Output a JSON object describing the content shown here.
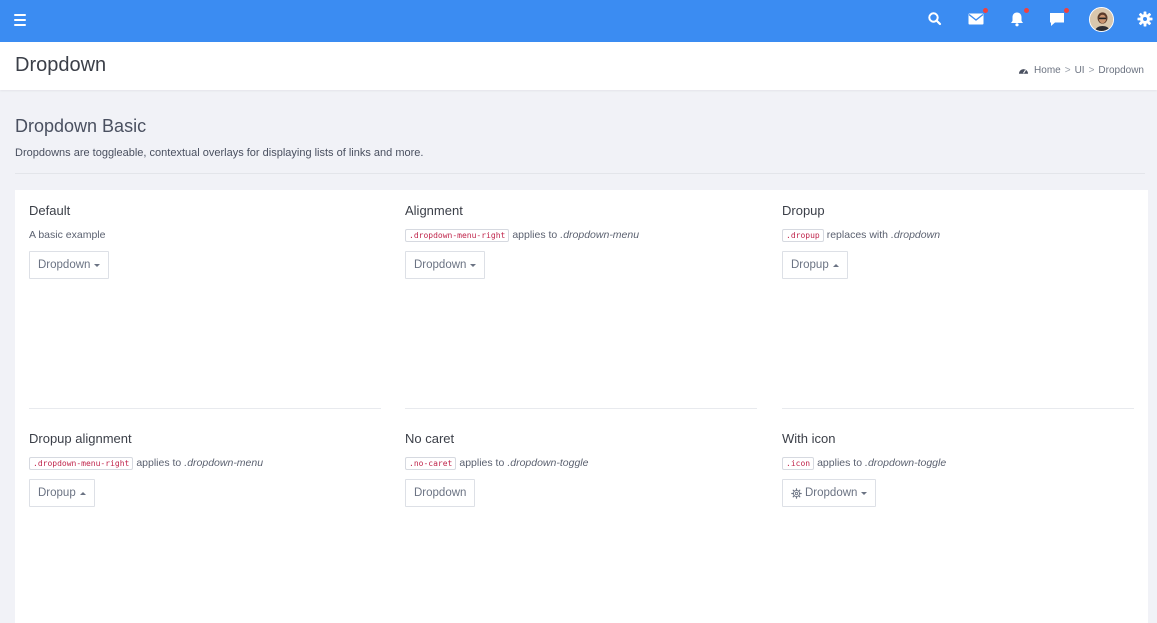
{
  "topbar": {
    "background": "#3b8cf2",
    "icons": [
      "menu-icon",
      "search-icon",
      "mail-icon",
      "bell-icon",
      "chat-icon",
      "avatar",
      "gear-icon"
    ],
    "notification_dot_color": "#f0413d"
  },
  "header": {
    "title": "Dropdown",
    "breadcrumb": {
      "home": "Home",
      "ui": "UI",
      "current": "Dropdown",
      "separator": ">"
    }
  },
  "section": {
    "title": "Dropdown Basic",
    "description": "Dropdowns are toggleable, contextual overlays for displaying lists of links and more."
  },
  "demos": [
    {
      "title": "Default",
      "desc_text": "A basic example",
      "button": "Dropdown"
    },
    {
      "title": "Alignment",
      "code": ".dropdown-menu-right",
      "desc_text": "applies to",
      "desc_em": ".dropdown-menu",
      "button": "Dropdown"
    },
    {
      "title": "Dropup",
      "code": ".dropup",
      "desc_text": "replaces with",
      "desc_em": ".dropdown",
      "button": "Dropup"
    },
    {
      "title": "Dropup alignment",
      "code": ".dropdown-menu-right",
      "desc_text": "applies to",
      "desc_em": ".dropdown-menu",
      "button": "Dropup"
    },
    {
      "title": "No caret",
      "code": ".no-caret",
      "desc_text": "applies to",
      "desc_em": ".dropdown-toggle",
      "button": "Dropdown"
    },
    {
      "title": "With icon",
      "code": ".icon",
      "desc_text": "applies to",
      "desc_em": ".dropdown-toggle",
      "button": "Dropdown"
    }
  ]
}
